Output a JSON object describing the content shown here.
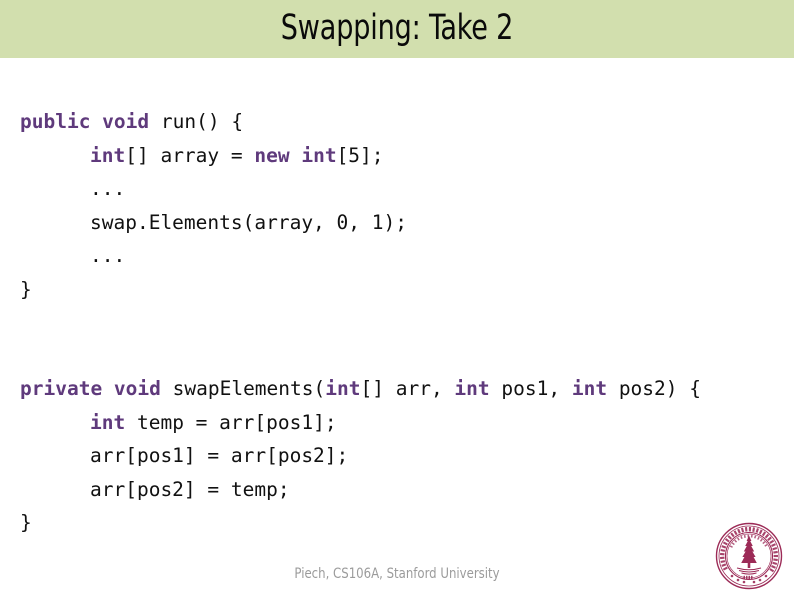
{
  "slide": {
    "title": "Swapping: Take 2",
    "band_color": "#d2dfae",
    "title_color": "#0a0a0a",
    "background_color": "#ffffff"
  },
  "code": {
    "keyword_color": "#5f3a7c",
    "text_color": "#111111",
    "blocks": [
      {
        "name": "run-method",
        "lines": [
          {
            "indent": 0,
            "segments": [
              {
                "text": "public void",
                "kind": "keyword"
              },
              {
                "text": " run() {",
                "kind": "plain"
              }
            ]
          },
          {
            "indent": 1,
            "segments": [
              {
                "text": "int",
                "kind": "keyword"
              },
              {
                "text": "[] array = ",
                "kind": "plain"
              },
              {
                "text": "new int",
                "kind": "keyword"
              },
              {
                "text": "[5];",
                "kind": "plain"
              }
            ]
          },
          {
            "indent": 1,
            "segments": [
              {
                "text": "...",
                "kind": "plain"
              }
            ]
          },
          {
            "indent": 1,
            "segments": [
              {
                "text": "swap.Elements(array, 0, 1);",
                "kind": "plain"
              }
            ]
          },
          {
            "indent": 1,
            "segments": [
              {
                "text": "...",
                "kind": "plain"
              }
            ]
          },
          {
            "indent": 0,
            "segments": [
              {
                "text": "}",
                "kind": "plain"
              }
            ]
          }
        ]
      },
      {
        "name": "swap-elements-method",
        "lines": [
          {
            "indent": 0,
            "segments": [
              {
                "text": "private void",
                "kind": "keyword"
              },
              {
                "text": " swapElements(",
                "kind": "plain"
              },
              {
                "text": "int",
                "kind": "keyword"
              },
              {
                "text": "[] arr, ",
                "kind": "plain"
              },
              {
                "text": "int",
                "kind": "keyword"
              },
              {
                "text": " pos1, ",
                "kind": "plain"
              },
              {
                "text": "int",
                "kind": "keyword"
              },
              {
                "text": " pos2) {",
                "kind": "plain"
              }
            ]
          },
          {
            "indent": 1,
            "segments": [
              {
                "text": "int",
                "kind": "keyword"
              },
              {
                "text": " temp = arr[pos1];",
                "kind": "plain"
              }
            ]
          },
          {
            "indent": 1,
            "segments": [
              {
                "text": "arr[pos1] = arr[pos2];",
                "kind": "plain"
              }
            ]
          },
          {
            "indent": 1,
            "segments": [
              {
                "text": "arr[pos2] = temp;",
                "kind": "plain"
              }
            ]
          },
          {
            "indent": 0,
            "segments": [
              {
                "text": "}",
                "kind": "plain"
              }
            ]
          }
        ]
      }
    ]
  },
  "footer": {
    "attribution": "Piech, CS106A, Stanford University",
    "color": "#9b9b9b"
  },
  "seal": {
    "name": "stanford-university-seal",
    "outer_ring_text": "LELAND STANFORD JUNIOR UNIVERSITY",
    "inner_motto": "DIE LUFT DER FREIHEIT WEHT",
    "year": "1891",
    "color": "#9c2b57"
  }
}
